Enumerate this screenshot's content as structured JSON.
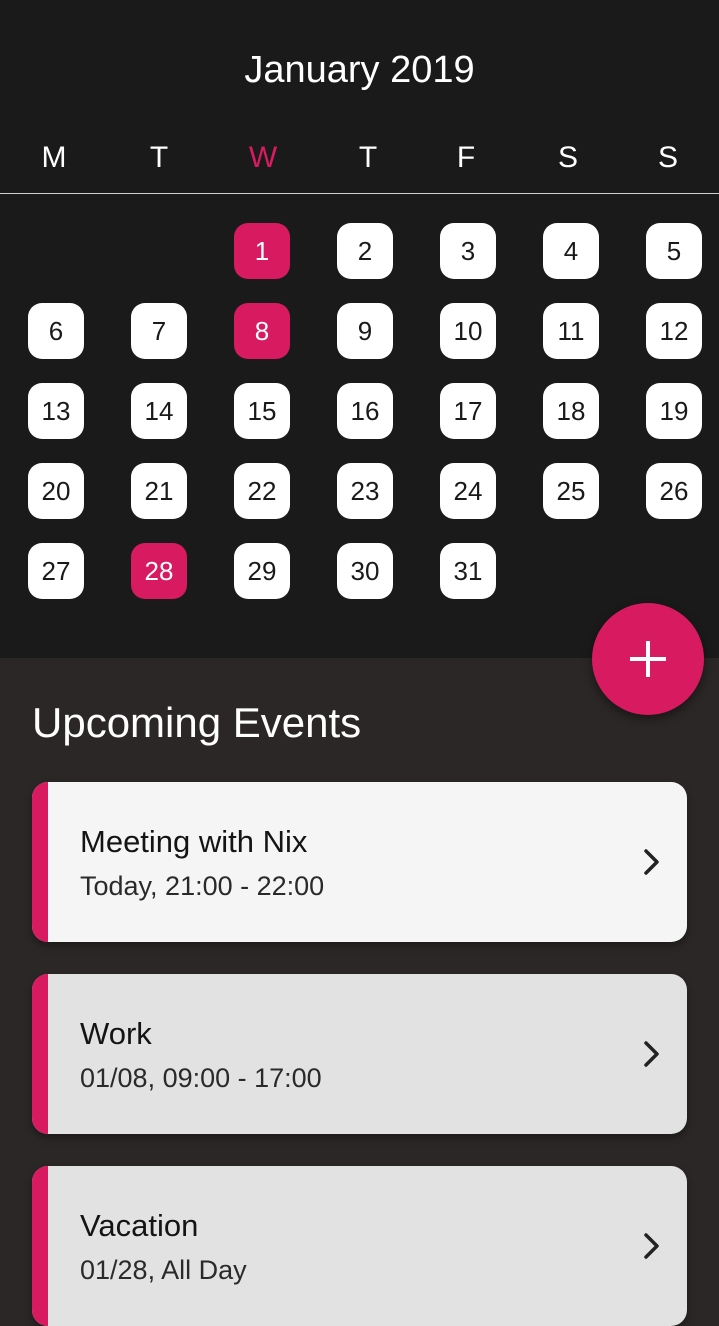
{
  "calendar": {
    "month_title": "January 2019",
    "weekdays": [
      "M",
      "T",
      "W",
      "T",
      "F",
      "S",
      "S"
    ],
    "current_weekday_index": 2,
    "current_weekday_color": "#d81b60",
    "days": [
      "1",
      "2",
      "3",
      "4",
      "5",
      "6",
      "7",
      "8",
      "9",
      "10",
      "11",
      "12",
      "13",
      "14",
      "15",
      "16",
      "17",
      "18",
      "19",
      "20",
      "21",
      "22",
      "23",
      "24",
      "25",
      "26",
      "27",
      "28",
      "29",
      "30",
      "31"
    ],
    "first_weekday_index": 2,
    "highlighted_days": [
      "1",
      "8",
      "28"
    ]
  },
  "fab": {
    "icon": "plus-icon",
    "color": "#d81b60"
  },
  "events_section": {
    "title": "Upcoming Events",
    "events": [
      {
        "title": "Meeting with Nix",
        "time": "Today, 21:00 - 22:00",
        "background": "#f5f5f5"
      },
      {
        "title": "Work",
        "time": "01/08, 09:00 - 17:00",
        "background": "#e2e2e2"
      },
      {
        "title": "Vacation",
        "time": "01/28, All Day",
        "background": "#e2e2e2"
      }
    ],
    "chevron_icon": "chevron-right-icon"
  },
  "colors": {
    "accent": "#d81b60",
    "calendar_bg": "#1b1a1a",
    "events_bg": "#2c2727"
  }
}
